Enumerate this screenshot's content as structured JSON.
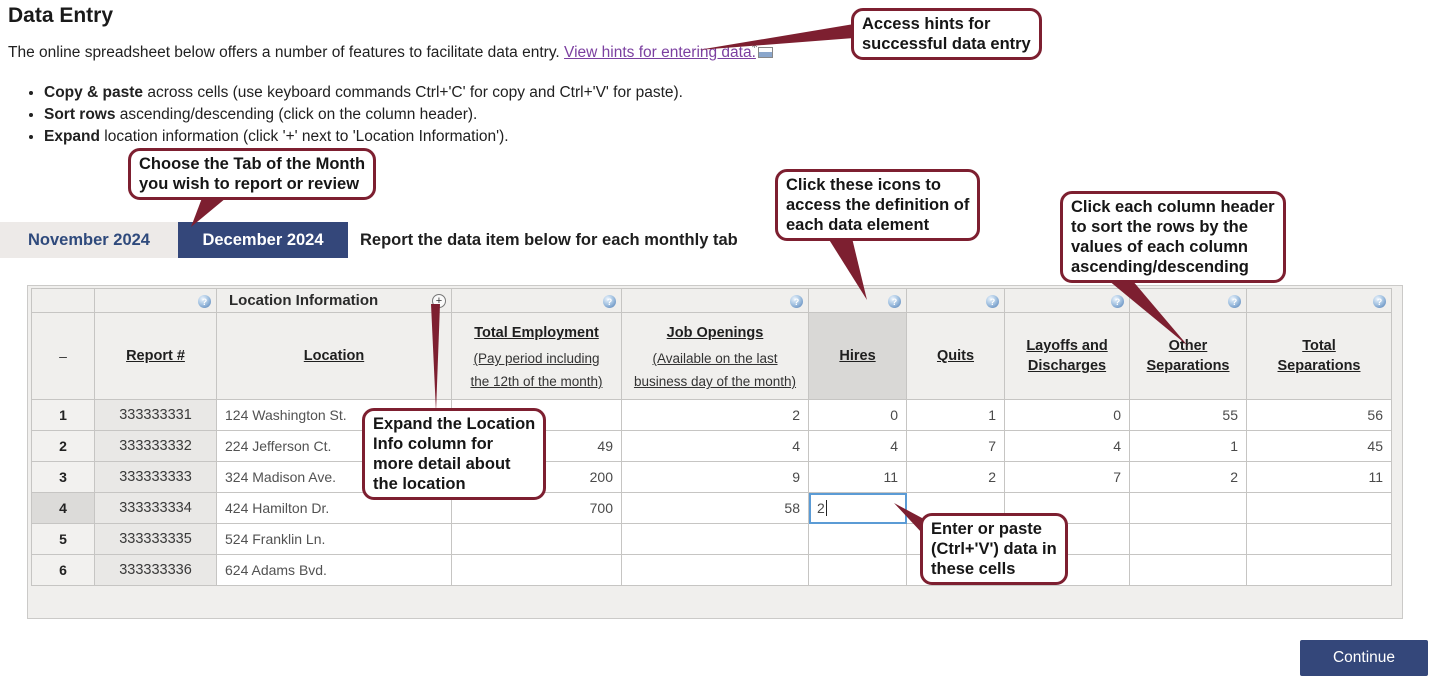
{
  "page": {
    "title": "Data Entry",
    "intro_text": "The online spreadsheet below offers a number of features to facilitate data entry.",
    "intro_link": "View hints for entering data.",
    "bullets": [
      {
        "bold": "Copy & paste",
        "rest": " across cells (use keyboard commands Ctrl+'C' for copy and Ctrl+'V' for paste)."
      },
      {
        "bold": "Sort rows",
        "rest": " ascending/descending (click on the column header)."
      },
      {
        "bold": "Expand",
        "rest": " location information (click '+' next to 'Location Information')."
      }
    ]
  },
  "tabs": [
    {
      "label": "November 2024",
      "active": false
    },
    {
      "label": "December 2024",
      "active": true
    }
  ],
  "tab_note": "Report the data item below for each monthly tab",
  "callouts": {
    "access_hints": {
      "lines": [
        "Access hints for",
        "successful data entry"
      ]
    },
    "choose_tab": {
      "lines": [
        "Choose the Tab of the Month",
        "you wish to report or review"
      ]
    },
    "click_icons": {
      "lines": [
        "Click these icons to",
        "access the definition of",
        "each data element"
      ]
    },
    "sort_columns": {
      "lines": [
        "Click each column header",
        "to sort the rows by the",
        "values of each column",
        "ascending/descending"
      ]
    },
    "expand_location": {
      "lines": [
        "Expand the Location",
        "Info column for",
        "more detail about",
        "the location"
      ]
    },
    "enter_paste": {
      "lines": [
        "Enter  or paste",
        "(Ctrl+'V') data in",
        "these cells"
      ]
    }
  },
  "table": {
    "group_header": "Location Information",
    "row_header_dash": "–",
    "help_icon_glyph": "?",
    "expand_icon_glyph": "+",
    "columns": [
      {
        "label": "Report #"
      },
      {
        "label": "Location"
      },
      {
        "label": "Total Employment",
        "sub": [
          "(Pay period including",
          "the 12th of the month)"
        ]
      },
      {
        "label": "Job Openings",
        "sub": [
          "(Available on the last",
          "business day of the month)"
        ]
      },
      {
        "label": "Hires"
      },
      {
        "label": "Quits"
      },
      {
        "label": "Layoffs and",
        "label2": "Discharges"
      },
      {
        "label": "Other",
        "label2": "Separations"
      },
      {
        "label": "Total",
        "label2": "Separations"
      }
    ],
    "rows": [
      {
        "num": "1",
        "report": "333333331",
        "location": "124 Washington St.",
        "total_employment": "",
        "job_openings": "2",
        "hires": "0",
        "quits": "1",
        "layoffs": "0",
        "other_separations": "55",
        "total_separations": "56"
      },
      {
        "num": "2",
        "report": "333333332",
        "location": "224 Jefferson Ct.",
        "total_employment": "49",
        "job_openings": "4",
        "hires": "4",
        "quits": "7",
        "layoffs": "4",
        "other_separations": "1",
        "total_separations": "45"
      },
      {
        "num": "3",
        "report": "333333333",
        "location": "324 Madison Ave.",
        "total_employment": "200",
        "job_openings": "9",
        "hires": "11",
        "quits": "2",
        "layoffs": "7",
        "other_separations": "2",
        "total_separations": "11"
      },
      {
        "num": "4",
        "report": "333333334",
        "location": "424 Hamilton Dr.",
        "total_employment": "700",
        "job_openings": "58",
        "hires": "2",
        "quits": "",
        "layoffs": "",
        "other_separations": "",
        "total_separations": ""
      },
      {
        "num": "5",
        "report": "333333335",
        "location": "524 Franklin Ln.",
        "total_employment": "",
        "job_openings": "",
        "hires": "",
        "quits": "",
        "layoffs": "",
        "other_separations": "",
        "total_separations": ""
      },
      {
        "num": "6",
        "report": "333333336",
        "location": "624 Adams Bvd.",
        "total_employment": "",
        "job_openings": "",
        "hires": "",
        "quits": "",
        "layoffs": "",
        "other_separations": "",
        "total_separations": ""
      }
    ]
  },
  "active_cell": {
    "row": "4",
    "column": "Hires"
  },
  "continue_button": "Continue",
  "colors": {
    "navy": "#34477a",
    "callout_maroon": "#7d1f30",
    "link_purple": "#7b3fa0",
    "active_cell_border": "#5b9bd5",
    "sorted_column_header": "#d9d8d6"
  }
}
